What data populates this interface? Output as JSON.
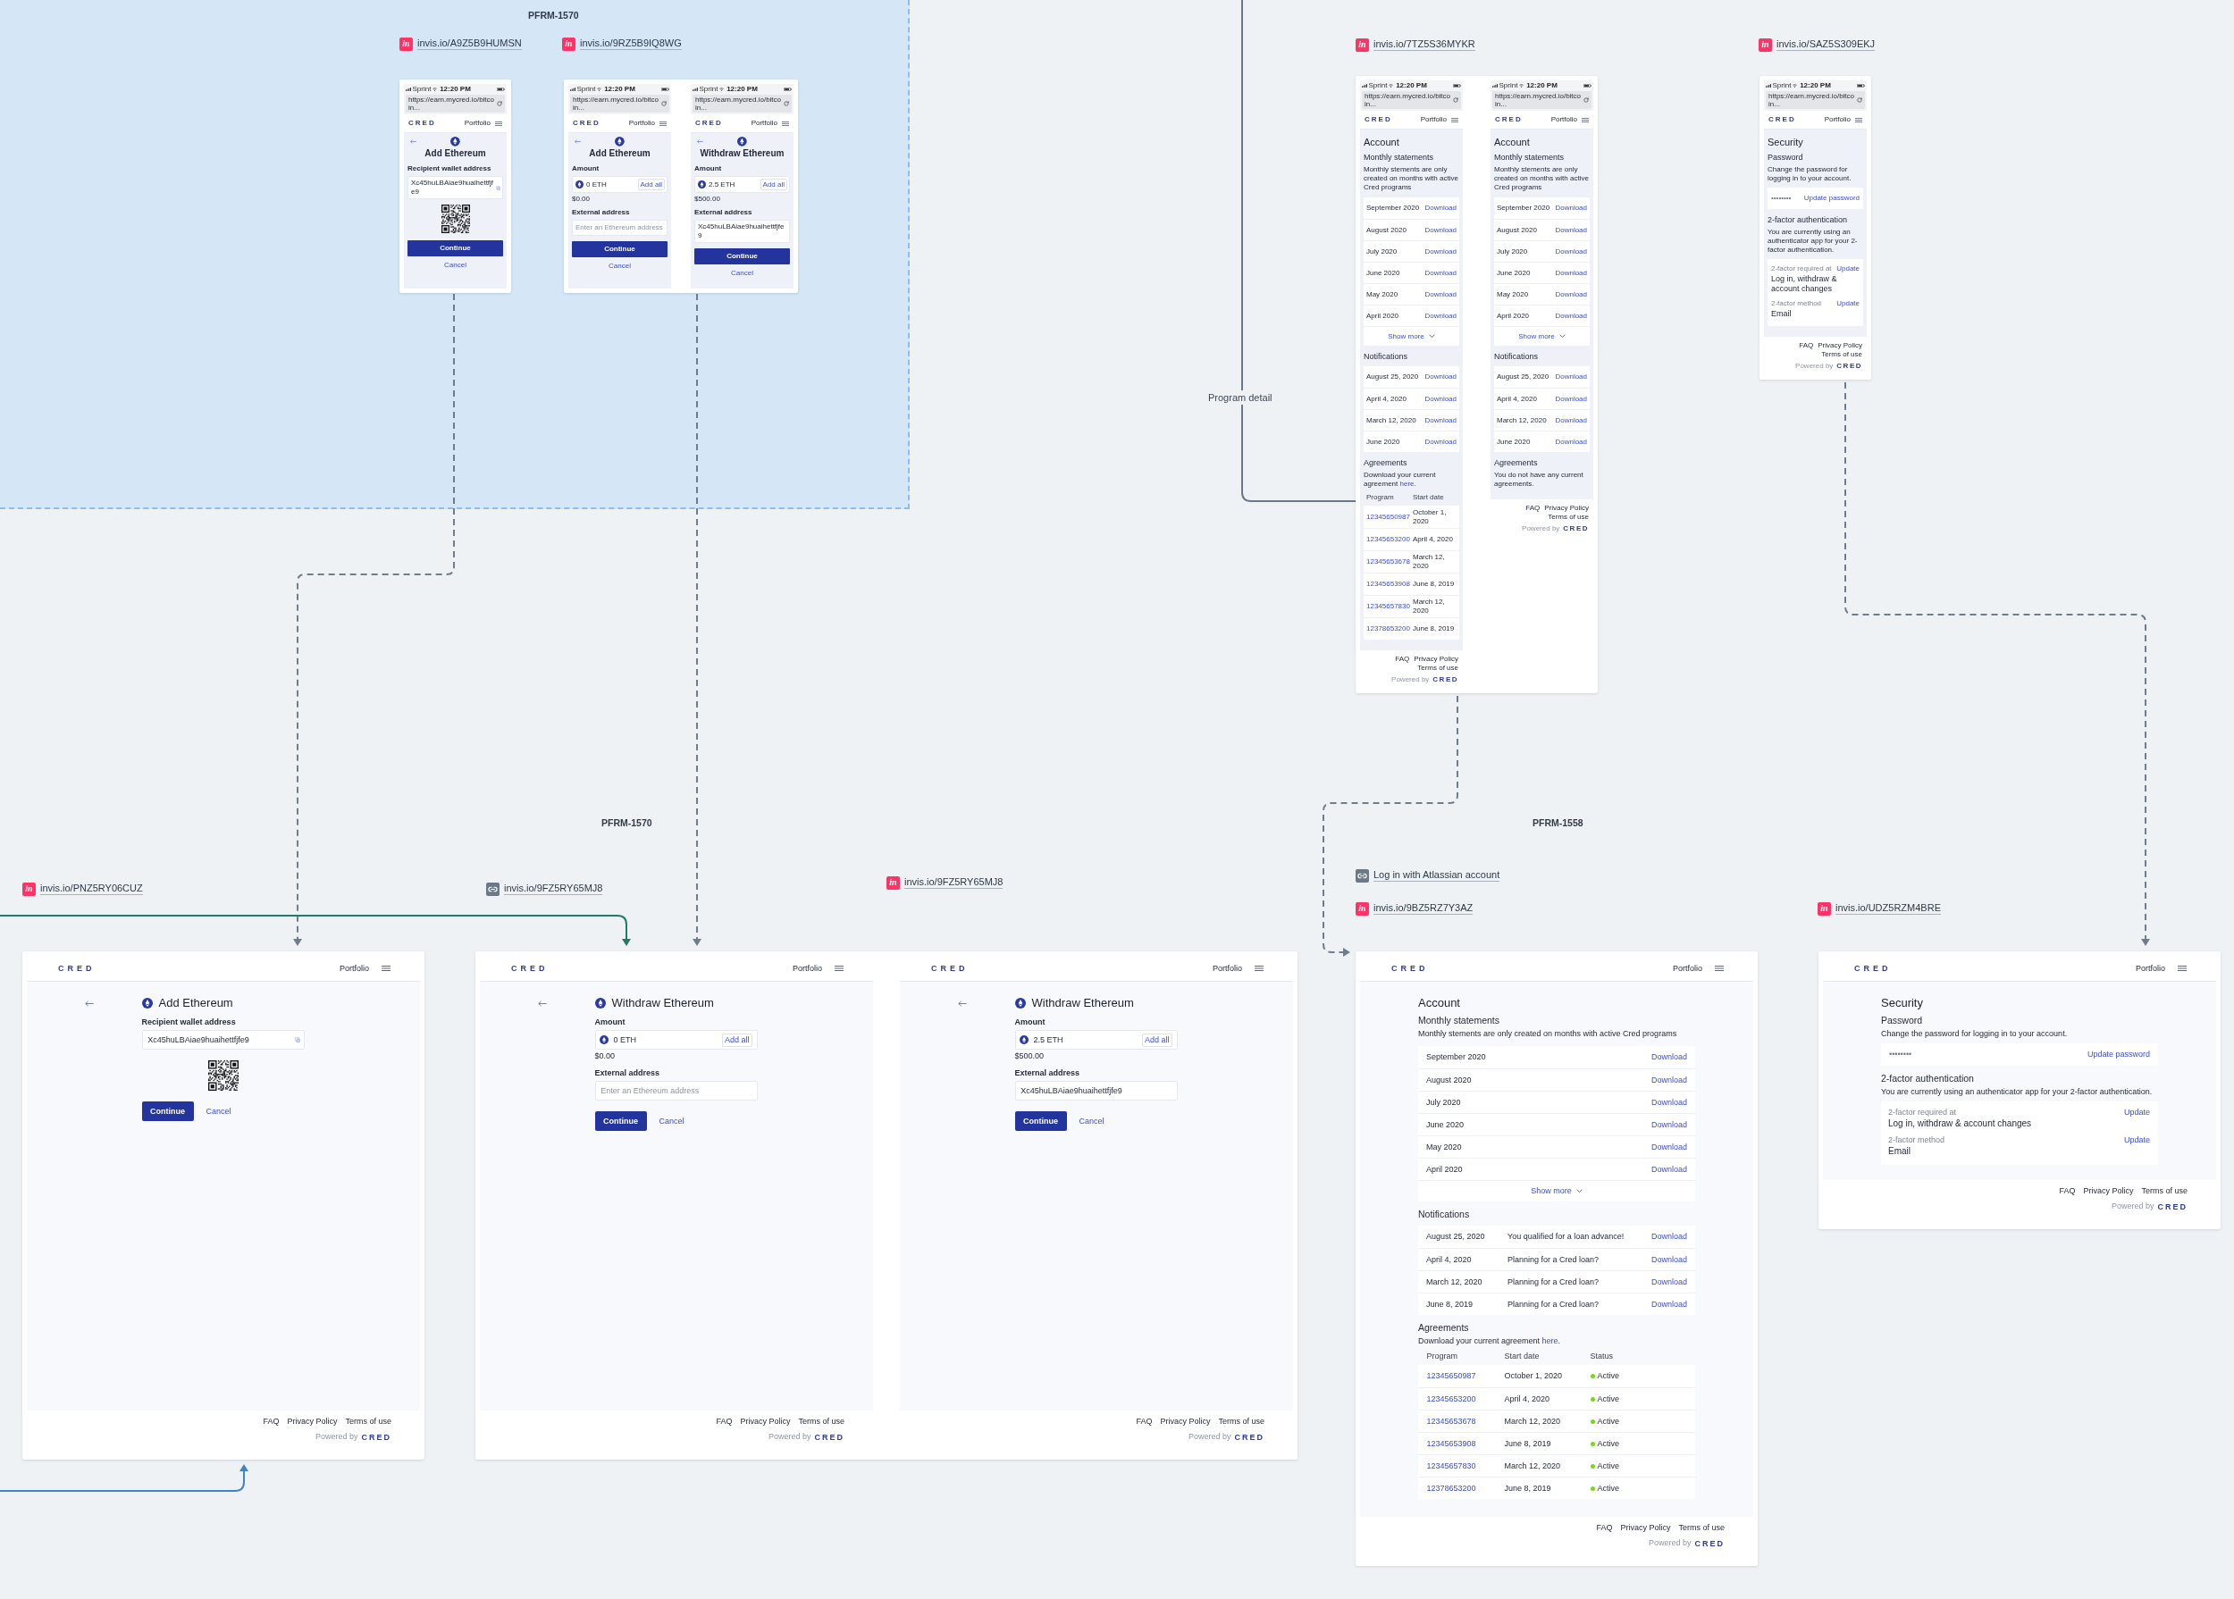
{
  "group": {
    "title": "PFRM-1570"
  },
  "links": [
    {
      "kind": "invision",
      "badge": "in",
      "text": "invis.io/A9Z5B9HUMSN"
    },
    {
      "kind": "invision",
      "badge": "in",
      "text": "invis.io/9RZ5B9IQ8WG"
    },
    {
      "kind": "invision",
      "badge": "in",
      "text": "invis.io/7TZ5S36MYKR"
    },
    {
      "kind": "invision",
      "badge": "in",
      "text": "invis.io/SAZ5S309EKJ"
    },
    {
      "kind": "invision",
      "badge": "in",
      "text": "invis.io/PNZ5RY06CUZ"
    },
    {
      "kind": "link",
      "text": "invis.io/9FZ5RY65MJ8"
    },
    {
      "kind": "invision",
      "badge": "in",
      "text": "invis.io/9FZ5RY65MJ8"
    },
    {
      "kind": "link",
      "text": "Log in with Atlassian account"
    },
    {
      "kind": "invision",
      "badge": "in",
      "text": "invis.io/9BZ5RZ7Y3AZ"
    },
    {
      "kind": "invision",
      "badge": "in",
      "text": "invis.io/UDZ5RZM4BRE"
    }
  ],
  "labels": [
    {
      "kind": "connector",
      "text": "Program detail"
    },
    {
      "kind": "section",
      "text": "PFRM-1570"
    },
    {
      "kind": "section",
      "text": "PFRM-1558"
    }
  ],
  "frames": [
    {
      "screens": [
        {
          "kind": "mobile",
          "status_bar": {
            "carrier": "Sprint",
            "time": "12:20 PM"
          },
          "url": "https://earn.mycred.io/bitcoin...",
          "header": {
            "logo": "CRED",
            "nav": "Portfolio"
          },
          "page": {
            "kind": "form",
            "title": "Add Ethereum",
            "fields": [
              {
                "kind": "address",
                "label": "Recipient wallet address",
                "value": "Xc45huLBAiae9huaihettfjfe9"
              },
              {
                "kind": "qr"
              }
            ],
            "primary": "Continue",
            "secondary": "Cancel"
          }
        }
      ]
    },
    {
      "screens": [
        {
          "kind": "mobile",
          "status_bar": {
            "carrier": "Sprint",
            "time": "12:20 PM"
          },
          "url": "https://earn.mycred.io/bitcoin...",
          "header": {
            "logo": "CRED",
            "nav": "Portfolio"
          },
          "page": {
            "kind": "form",
            "title": "Add Ethereum",
            "fields": [
              {
                "kind": "amount",
                "label": "Amount",
                "value": "0 ETH",
                "action": "Add all",
                "note": "$0.00"
              },
              {
                "kind": "text",
                "label": "External address",
                "placeholder": "Enter an Ethereum address"
              }
            ],
            "primary": "Continue",
            "secondary": "Cancel"
          }
        },
        {
          "kind": "mobile",
          "status_bar": {
            "carrier": "Sprint",
            "time": "12:20 PM"
          },
          "url": "https://earn.mycred.io/bitcoin...",
          "header": {
            "logo": "CRED",
            "nav": "Portfolio"
          },
          "page": {
            "kind": "form",
            "title": "Withdraw Ethereum",
            "fields": [
              {
                "kind": "amount",
                "label": "Amount",
                "value": "2.5 ETH",
                "action": "Add all",
                "note": "$500.00"
              },
              {
                "kind": "text",
                "label": "External address",
                "value": "Xc45huLBAiae9huaihettfjfe9"
              }
            ],
            "primary": "Continue",
            "secondary": "Cancel"
          }
        }
      ]
    },
    {
      "screens": [
        {
          "kind": "mobile",
          "status_bar": {
            "carrier": "Sprint",
            "time": "12:20 PM"
          },
          "url": "https://earn.mycred.io/bitcoin...",
          "header": {
            "logo": "CRED",
            "nav": "Portfolio"
          },
          "page": {
            "kind": "sections",
            "title": "Account",
            "sections": [
              {
                "kind": "list",
                "heading": "Monthly statements",
                "description": "Monthly stements are only created on months with active Cred programs",
                "rows": [
                  {
                    "cells": [
                      "September 2020"
                    ],
                    "action": "Download"
                  },
                  {
                    "cells": [
                      "August 2020"
                    ],
                    "action": "Download"
                  },
                  {
                    "cells": [
                      "July 2020"
                    ],
                    "action": "Download"
                  },
                  {
                    "cells": [
                      "June 2020"
                    ],
                    "action": "Download"
                  },
                  {
                    "cells": [
                      "May 2020"
                    ],
                    "action": "Download"
                  },
                  {
                    "cells": [
                      "April 2020"
                    ],
                    "action": "Download"
                  }
                ],
                "more": "Show more"
              },
              {
                "kind": "list",
                "heading": "Notifications",
                "rows": [
                  {
                    "cells": [
                      "August 25, 2020"
                    ],
                    "action": "Download"
                  },
                  {
                    "cells": [
                      "April 4, 2020"
                    ],
                    "action": "Download"
                  },
                  {
                    "cells": [
                      "March 12, 2020"
                    ],
                    "action": "Download"
                  },
                  {
                    "cells": [
                      "June 2020"
                    ],
                    "action": "Download"
                  }
                ]
              },
              {
                "kind": "table",
                "heading": "Agreements",
                "description": "Download your current agreement",
                "link": "here",
                "after": ".",
                "columns": [
                  "Program",
                  "Start date"
                ],
                "rows": [
                  {
                    "program": "12345650987",
                    "start": "October 1, 2020"
                  },
                  {
                    "program": "12345653200",
                    "start": "April 4, 2020"
                  },
                  {
                    "program": "12345653678",
                    "start": "March 12, 2020"
                  },
                  {
                    "program": "12345653908",
                    "start": "June 8, 2019"
                  },
                  {
                    "program": "12345657830",
                    "start": "March 12, 2020"
                  },
                  {
                    "program": "12378653200",
                    "start": "June 8, 2019"
                  }
                ]
              }
            ]
          },
          "footer": {
            "links": [
              "FAQ",
              "Privacy Policy",
              "Terms of use"
            ],
            "powered_by": "Powered by",
            "logo": "CRED"
          }
        },
        {
          "kind": "mobile",
          "status_bar": {
            "carrier": "Sprint",
            "time": "12:20 PM"
          },
          "url": "https://earn.mycred.io/bitcoin...",
          "header": {
            "logo": "CRED",
            "nav": "Portfolio"
          },
          "page": {
            "kind": "sections",
            "title": "Account",
            "sections": [
              {
                "kind": "list",
                "heading": "Monthly statements",
                "description": "Monthly stements are only created on months with active Cred programs",
                "rows": [
                  {
                    "cells": [
                      "September 2020"
                    ],
                    "action": "Download"
                  },
                  {
                    "cells": [
                      "August 2020"
                    ],
                    "action": "Download"
                  },
                  {
                    "cells": [
                      "July 2020"
                    ],
                    "action": "Download"
                  },
                  {
                    "cells": [
                      "June 2020"
                    ],
                    "action": "Download"
                  },
                  {
                    "cells": [
                      "May 2020"
                    ],
                    "action": "Download"
                  },
                  {
                    "cells": [
                      "April 2020"
                    ],
                    "action": "Download"
                  }
                ],
                "more": "Show more"
              },
              {
                "kind": "list",
                "heading": "Notifications",
                "rows": [
                  {
                    "cells": [
                      "August 25, 2020"
                    ],
                    "action": "Download"
                  },
                  {
                    "cells": [
                      "April 4, 2020"
                    ],
                    "action": "Download"
                  },
                  {
                    "cells": [
                      "March 12, 2020"
                    ],
                    "action": "Download"
                  },
                  {
                    "cells": [
                      "June 2020"
                    ],
                    "action": "Download"
                  }
                ]
              },
              {
                "kind": "table",
                "heading": "Agreements",
                "description": "You do not have any current agreements."
              }
            ]
          },
          "footer": {
            "links": [
              "FAQ",
              "Privacy Policy",
              "Terms of use"
            ],
            "powered_by": "Powered by",
            "logo": "CRED"
          }
        }
      ]
    },
    {
      "screens": [
        {
          "kind": "mobile",
          "status_bar": {
            "carrier": "Sprint",
            "time": "12:20 PM"
          },
          "url": "https://earn.mycred.io/bitcoin...",
          "header": {
            "logo": "CRED",
            "nav": "Portfolio"
          },
          "page": {
            "kind": "sections",
            "title": "Security",
            "sections": [
              {
                "kind": "password",
                "heading": "Password",
                "description": "Change the password for logging in to your account.",
                "value": "••••••••",
                "action": "Update password"
              },
              {
                "kind": "settings",
                "heading": "2-factor authentication",
                "description": "You are currently using an authenticator app for your 2-factor authentication.",
                "items": [
                  {
                    "label": "2-factor required at",
                    "value": "Log in, withdraw & account changes",
                    "action": "Update"
                  },
                  {
                    "label": "2-factor method",
                    "value": "Email",
                    "action": "Update"
                  }
                ]
              }
            ]
          },
          "footer": {
            "links": [
              "FAQ",
              "Privacy Policy",
              "Terms of use"
            ],
            "powered_by": "Powered by",
            "logo": "CRED"
          }
        }
      ]
    },
    {
      "screens": [
        {
          "kind": "desktop",
          "header": {
            "logo": "CRED",
            "nav": "Portfolio"
          },
          "page": {
            "kind": "form",
            "title": "Add Ethereum",
            "fields": [
              {
                "kind": "address",
                "label": "Recipient wallet address",
                "value": "Xc45huLBAiae9huaihettfjfe9"
              },
              {
                "kind": "qr"
              }
            ],
            "primary": "Continue",
            "secondary": "Cancel"
          },
          "footer": {
            "links": [
              "FAQ",
              "Privacy Policy",
              "Terms of use"
            ],
            "powered_by": "Powered by",
            "logo": "CRED"
          }
        }
      ]
    },
    {
      "screens": [
        {
          "kind": "desktop",
          "header": {
            "logo": "CRED",
            "nav": "Portfolio"
          },
          "page": {
            "kind": "form",
            "title": "Withdraw Ethereum",
            "fields": [
              {
                "kind": "amount",
                "label": "Amount",
                "value": "0 ETH",
                "action": "Add all",
                "note": "$0.00"
              },
              {
                "kind": "text",
                "label": "External address",
                "placeholder": "Enter an Ethereum address"
              }
            ],
            "primary": "Continue",
            "secondary": "Cancel"
          },
          "footer": {
            "links": [
              "FAQ",
              "Privacy Policy",
              "Terms of use"
            ],
            "powered_by": "Powered by",
            "logo": "CRED"
          }
        },
        {
          "kind": "desktop",
          "header": {
            "logo": "CRED",
            "nav": "Portfolio"
          },
          "page": {
            "kind": "form",
            "title": "Withdraw Ethereum",
            "fields": [
              {
                "kind": "amount",
                "label": "Amount",
                "value": "2.5 ETH",
                "action": "Add all",
                "note": "$500.00"
              },
              {
                "kind": "text",
                "label": "External address",
                "value": "Xc45huLBAiae9huaihettfjfe9"
              }
            ],
            "primary": "Continue",
            "secondary": "Cancel"
          },
          "footer": {
            "links": [
              "FAQ",
              "Privacy Policy",
              "Terms of use"
            ],
            "powered_by": "Powered by",
            "logo": "CRED"
          }
        }
      ]
    },
    {
      "screens": [
        {
          "kind": "desktop",
          "header": {
            "logo": "CRED",
            "nav": "Portfolio"
          },
          "page": {
            "kind": "sections",
            "title": "Account",
            "sections": [
              {
                "kind": "list",
                "heading": "Monthly statements",
                "description": "Monthly stements are only created on months with active Cred programs",
                "rows": [
                  {
                    "cells": [
                      "September 2020"
                    ],
                    "action": "Download"
                  },
                  {
                    "cells": [
                      "August 2020"
                    ],
                    "action": "Download"
                  },
                  {
                    "cells": [
                      "July 2020"
                    ],
                    "action": "Download"
                  },
                  {
                    "cells": [
                      "June 2020"
                    ],
                    "action": "Download"
                  },
                  {
                    "cells": [
                      "May 2020"
                    ],
                    "action": "Download"
                  },
                  {
                    "cells": [
                      "April 2020"
                    ],
                    "action": "Download"
                  }
                ],
                "more": "Show more"
              },
              {
                "kind": "list",
                "heading": "Notifications",
                "rows": [
                  {
                    "cells": [
                      "August 25, 2020",
                      "You qualified for a loan advance!"
                    ],
                    "action": "Download"
                  },
                  {
                    "cells": [
                      "April 4, 2020",
                      "Planning for a Cred loan?"
                    ],
                    "action": "Download"
                  },
                  {
                    "cells": [
                      "March 12, 2020",
                      "Planning for a Cred loan?"
                    ],
                    "action": "Download"
                  },
                  {
                    "cells": [
                      "June 8, 2019",
                      "Planning for a Cred loan?"
                    ],
                    "action": "Download"
                  }
                ]
              },
              {
                "kind": "table",
                "heading": "Agreements",
                "description": "Download your current agreement",
                "link": "here",
                "after": ".",
                "columns": [
                  "Program",
                  "Start date",
                  "Status"
                ],
                "rows": [
                  {
                    "program": "12345650987",
                    "start": "October 1, 2020",
                    "status": {
                      "text": "Active",
                      "color": "#7ed321"
                    }
                  },
                  {
                    "program": "12345653200",
                    "start": "April 4, 2020",
                    "status": {
                      "text": "Active",
                      "color": "#7ed321"
                    }
                  },
                  {
                    "program": "12345653678",
                    "start": "March 12, 2020",
                    "status": {
                      "text": "Active",
                      "color": "#7ed321"
                    }
                  },
                  {
                    "program": "12345653908",
                    "start": "June 8, 2019",
                    "status": {
                      "text": "Active",
                      "color": "#7ed321"
                    }
                  },
                  {
                    "program": "12345657830",
                    "start": "March 12, 2020",
                    "status": {
                      "text": "Active",
                      "color": "#7ed321"
                    }
                  },
                  {
                    "program": "12378653200",
                    "start": "June 8, 2019",
                    "status": {
                      "text": "Active",
                      "color": "#7ed321"
                    }
                  }
                ]
              }
            ]
          },
          "footer": {
            "links": [
              "FAQ",
              "Privacy Policy",
              "Terms of use"
            ],
            "powered_by": "Powered by",
            "logo": "CRED"
          }
        }
      ]
    },
    {
      "screens": [
        {
          "kind": "desktop",
          "header": {
            "logo": "CRED",
            "nav": "Portfolio"
          },
          "page": {
            "kind": "sections",
            "title": "Security",
            "sections": [
              {
                "kind": "password",
                "heading": "Password",
                "description": "Change the password for logging in to your account.",
                "value": "••••••••",
                "action": "Update password"
              },
              {
                "kind": "settings",
                "heading": "2-factor authentication",
                "description": "You are currently using an authenticator app for your 2-factor authentication.",
                "items": [
                  {
                    "label": "2-factor required at",
                    "value": "Log in, withdraw & account changes",
                    "action": "Update"
                  },
                  {
                    "label": "2-factor method",
                    "value": "Email",
                    "action": "Update"
                  }
                ]
              }
            ]
          },
          "footer": {
            "links": [
              "FAQ",
              "Privacy Policy",
              "Terms of use"
            ],
            "powered_by": "Powered by",
            "logo": "CRED"
          }
        }
      ]
    }
  ]
}
